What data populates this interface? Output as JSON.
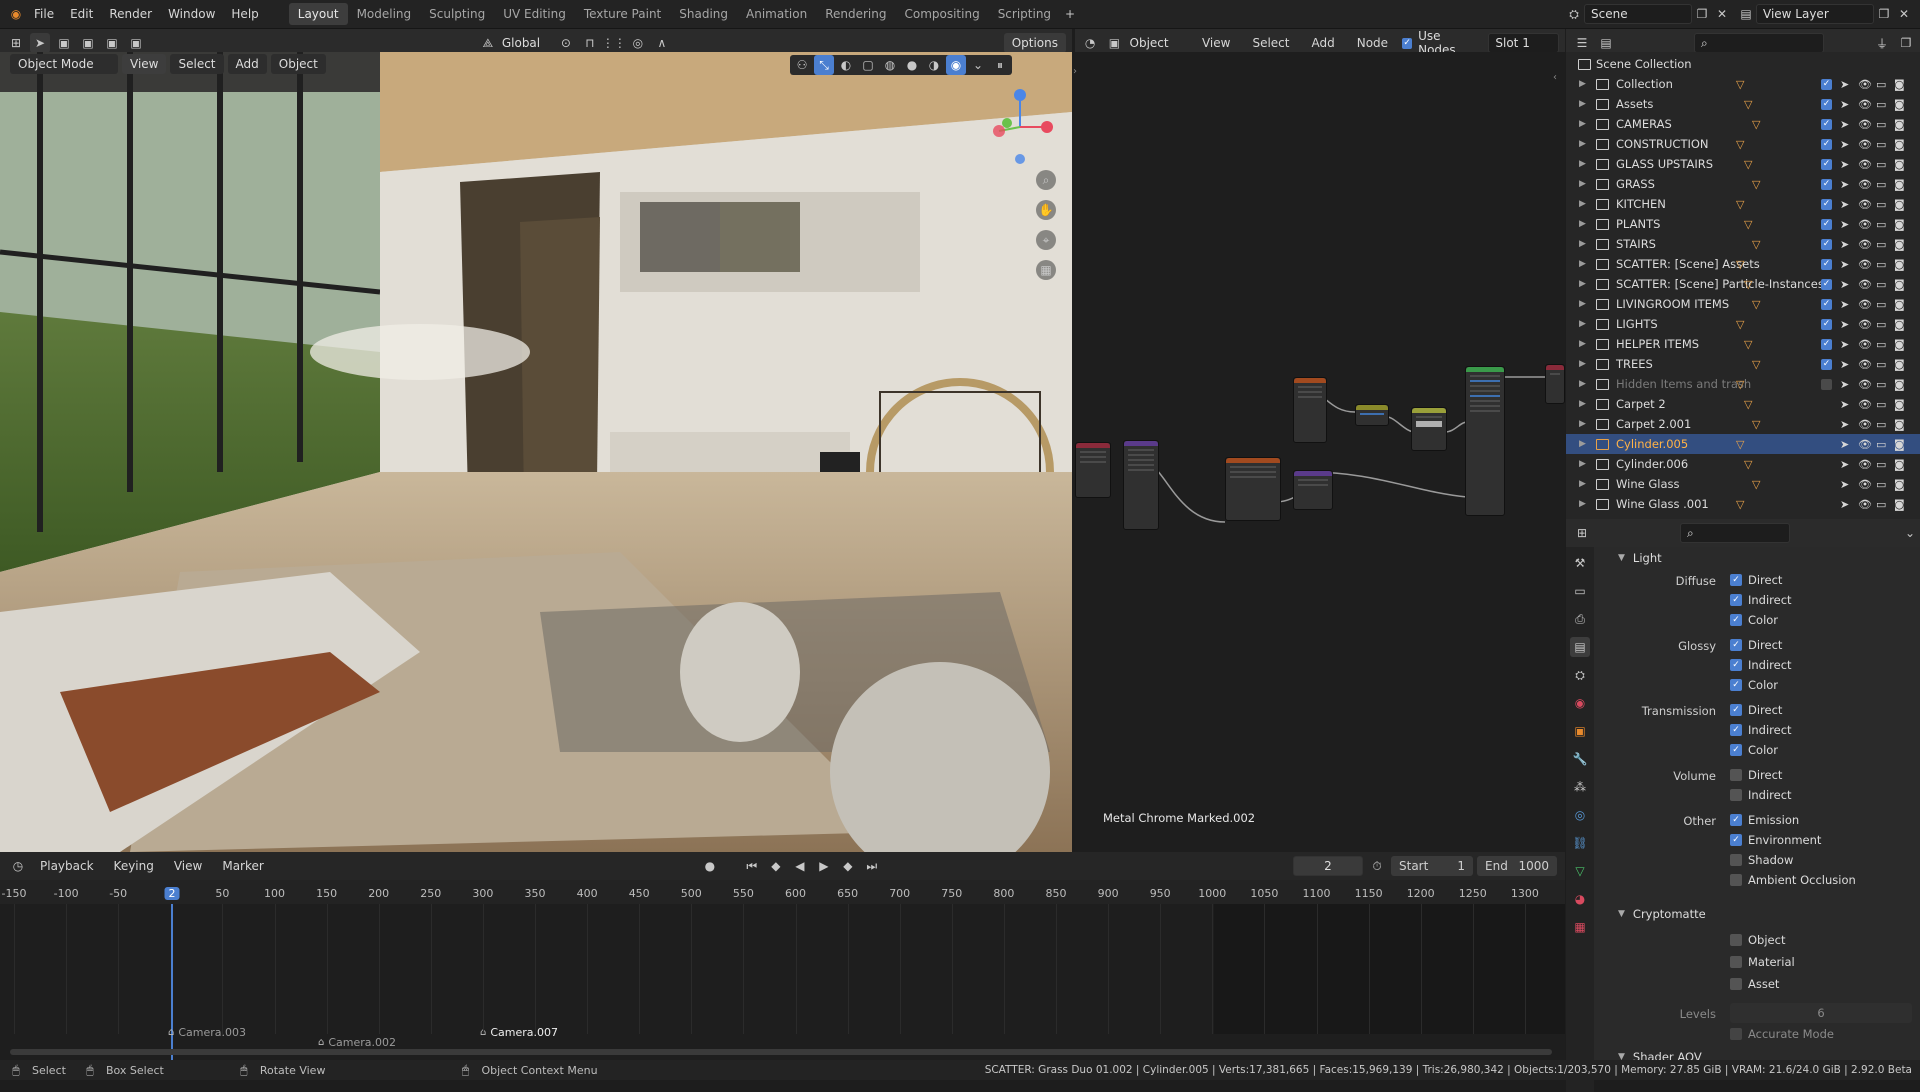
{
  "topbar": {
    "menus": [
      "File",
      "Edit",
      "Render",
      "Window",
      "Help"
    ],
    "workspaces": [
      "Layout",
      "Modeling",
      "Sculpting",
      "UV Editing",
      "Texture Paint",
      "Shading",
      "Animation",
      "Rendering",
      "Compositing",
      "Scripting"
    ],
    "active_workspace": "Layout",
    "scene": "Scene",
    "view_layer": "View Layer"
  },
  "viewport_header": {
    "mode": "Object Mode",
    "menus": [
      "View",
      "Select",
      "Add",
      "Object"
    ],
    "transform": "Global",
    "options": "Options"
  },
  "node_header": {
    "object": "Object",
    "menus": [
      "View",
      "Select",
      "Add",
      "Node"
    ],
    "use_nodes": "Use Nodes",
    "slot": "Slot 1",
    "material_label": "Metal Chrome Marked.002"
  },
  "outliner": {
    "root": "Scene Collection",
    "rows": [
      {
        "label": "Collection",
        "selected": false,
        "dim": false
      },
      {
        "label": "Assets",
        "selected": false,
        "dim": false
      },
      {
        "label": "CAMERAS",
        "selected": false,
        "dim": false
      },
      {
        "label": "CONSTRUCTION",
        "selected": false,
        "dim": false
      },
      {
        "label": "GLASS UPSTAIRS",
        "selected": false,
        "dim": false
      },
      {
        "label": "GRASS",
        "selected": false,
        "dim": false
      },
      {
        "label": "KITCHEN",
        "selected": false,
        "dim": false
      },
      {
        "label": "PLANTS",
        "selected": false,
        "dim": false
      },
      {
        "label": "STAIRS",
        "selected": false,
        "dim": false
      },
      {
        "label": "SCATTER: [Scene] Assets",
        "selected": false,
        "dim": false
      },
      {
        "label": "SCATTER: [Scene] Particle-Instances",
        "selected": false,
        "dim": false
      },
      {
        "label": "LIVINGROOM ITEMS",
        "selected": false,
        "dim": false
      },
      {
        "label": "LIGHTS",
        "selected": false,
        "dim": false
      },
      {
        "label": "HELPER ITEMS",
        "selected": false,
        "dim": false
      },
      {
        "label": "TREES",
        "selected": false,
        "dim": false
      },
      {
        "label": "Hidden Items and trash",
        "selected": false,
        "dim": true
      },
      {
        "label": "Carpet 2",
        "selected": false,
        "dim": false
      },
      {
        "label": "Carpet 2.001",
        "selected": false,
        "dim": false
      },
      {
        "label": "Cylinder.005",
        "selected": true,
        "dim": false
      },
      {
        "label": "Cylinder.006",
        "selected": false,
        "dim": false
      },
      {
        "label": "Wine Glass",
        "selected": false,
        "dim": false
      },
      {
        "label": "Wine Glass .001",
        "selected": false,
        "dim": false
      }
    ]
  },
  "properties": {
    "panel_light": "Light",
    "groups": [
      {
        "label": "Diffuse",
        "items": [
          {
            "t": "Direct",
            "on": true
          },
          {
            "t": "Indirect",
            "on": true
          },
          {
            "t": "Color",
            "on": true
          }
        ]
      },
      {
        "label": "Glossy",
        "items": [
          {
            "t": "Direct",
            "on": true
          },
          {
            "t": "Indirect",
            "on": true
          },
          {
            "t": "Color",
            "on": true
          }
        ]
      },
      {
        "label": "Transmission",
        "items": [
          {
            "t": "Direct",
            "on": true
          },
          {
            "t": "Indirect",
            "on": true
          },
          {
            "t": "Color",
            "on": true
          }
        ]
      },
      {
        "label": "Volume",
        "items": [
          {
            "t": "Direct",
            "on": false
          },
          {
            "t": "Indirect",
            "on": false
          }
        ]
      },
      {
        "label": "Other",
        "items": [
          {
            "t": "Emission",
            "on": true
          },
          {
            "t": "Environment",
            "on": true
          },
          {
            "t": "Shadow",
            "on": false
          },
          {
            "t": "Ambient Occlusion",
            "on": false
          }
        ]
      }
    ],
    "panel_crypto": "Cryptomatte",
    "crypto_items": [
      {
        "t": "Object",
        "on": false
      },
      {
        "t": "Material",
        "on": false
      },
      {
        "t": "Asset",
        "on": false
      }
    ],
    "levels_label": "Levels",
    "levels_value": "6",
    "accurate_mode": "Accurate Mode",
    "next_panel": "Shader AOV"
  },
  "timeline": {
    "menus": [
      "Playback",
      "Keying",
      "View",
      "Marker"
    ],
    "current_frame": "2",
    "start_label": "Start",
    "start": "1",
    "end_label": "End",
    "end": "1000",
    "ticks": [
      "-150",
      "-100",
      "-50",
      "2",
      "50",
      "100",
      "150",
      "200",
      "250",
      "300",
      "350",
      "400",
      "450",
      "500",
      "550",
      "600",
      "650",
      "700",
      "750",
      "800",
      "850",
      "900",
      "950",
      "1000",
      "1050",
      "1100",
      "1150",
      "1200",
      "1250",
      "1300"
    ],
    "markers": [
      "Camera.003",
      "Camera.002",
      "Camera.007"
    ]
  },
  "statusbar": {
    "select": "Select",
    "box_select": "Box Select",
    "rotate": "Rotate View",
    "context": "Object Context Menu",
    "stats": "SCATTER: Grass Duo 01.002 | Cylinder.005 | Verts:17,381,665 | Faces:15,969,139 | Tris:26,980,342 | Objects:1/203,570 | Memory: 27.85 GiB | VRAM: 21.6/24.0 GiB | 2.92.0 Beta"
  },
  "colors": {
    "accent": "#4b7fd0",
    "selection": "#334e80",
    "header": "#232323",
    "panel": "#2a2a2a"
  }
}
